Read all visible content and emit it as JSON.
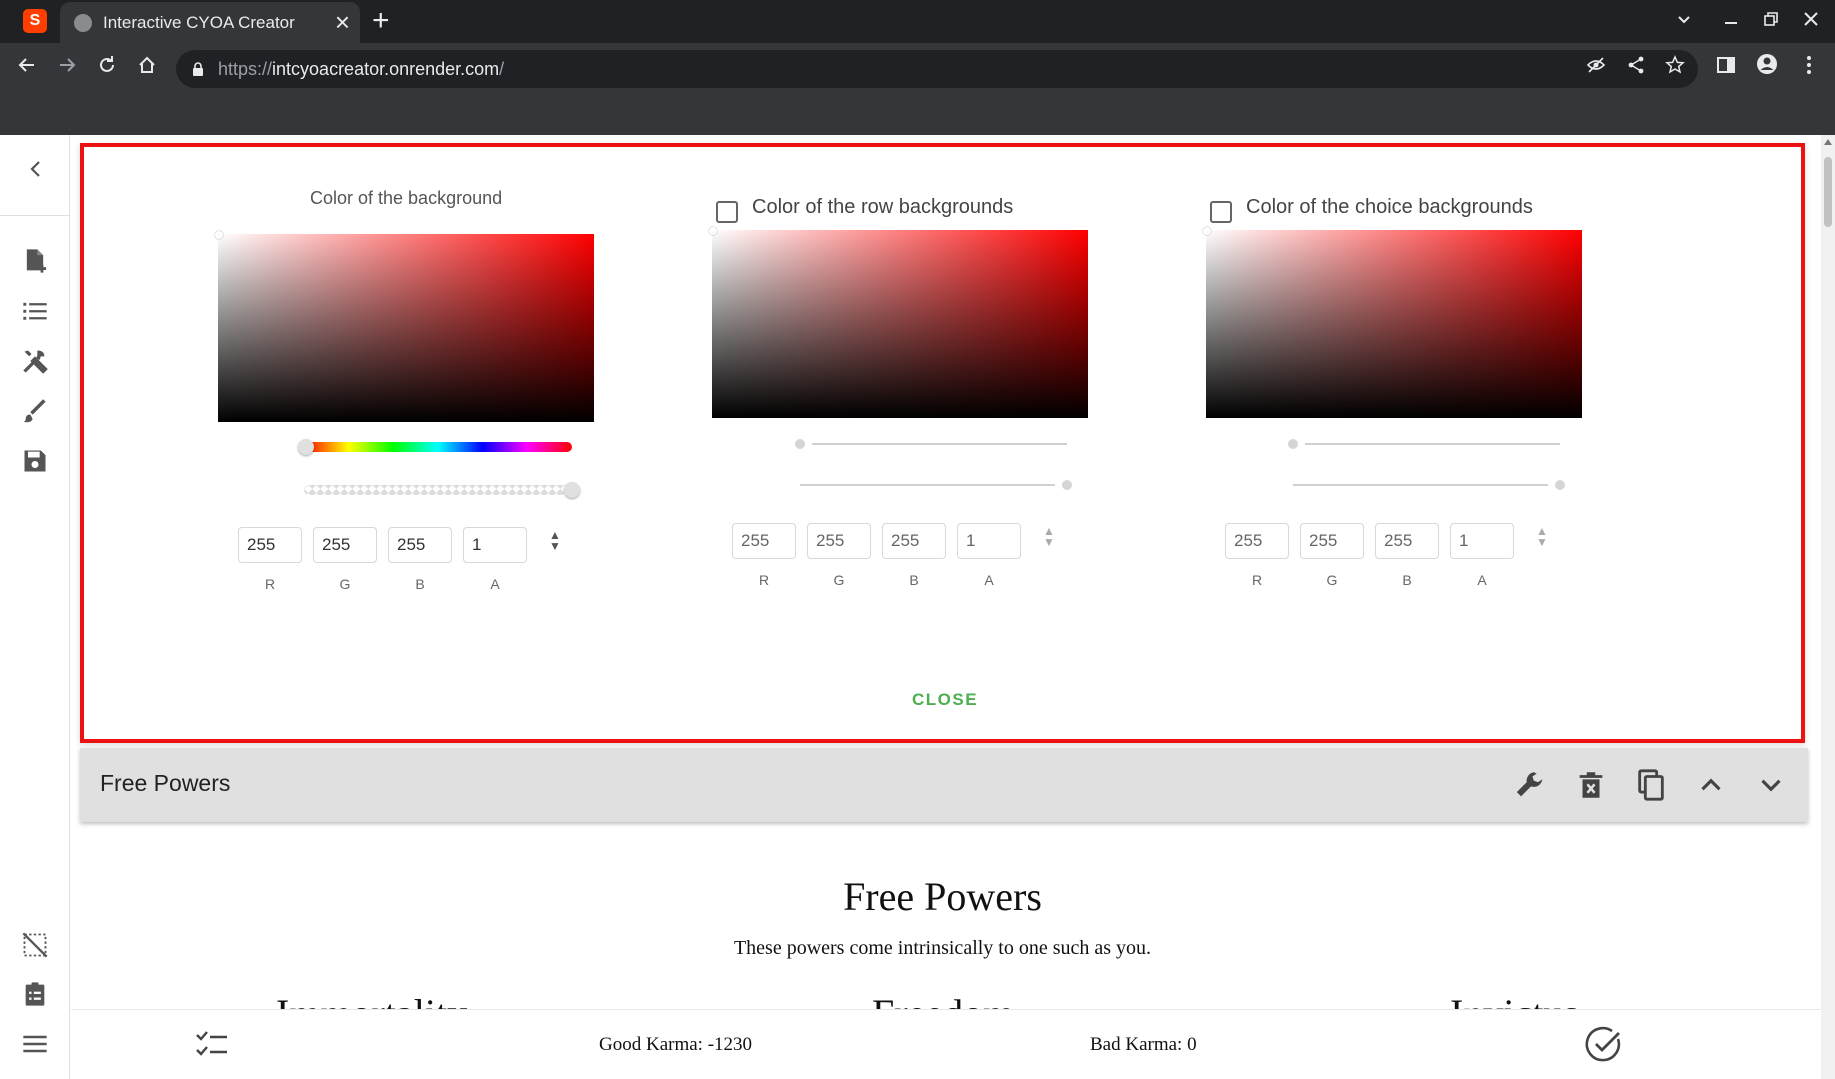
{
  "browser": {
    "tab_title": "Interactive CYOA Creator",
    "url_scheme": "https://",
    "url_host": "intcyoacreator.onrender.com",
    "url_path": "/",
    "app_logo": "S"
  },
  "dialog": {
    "pickers": [
      {
        "title": "Color of the background",
        "has_checkbox": false,
        "checked": false,
        "r": "255",
        "g": "255",
        "b": "255",
        "a": "1",
        "labels": {
          "r": "R",
          "g": "G",
          "b": "B",
          "a": "A"
        }
      },
      {
        "title": "Color of the row backgrounds",
        "has_checkbox": true,
        "checked": false,
        "r": "255",
        "g": "255",
        "b": "255",
        "a": "1",
        "labels": {
          "r": "R",
          "g": "G",
          "b": "B",
          "a": "A"
        }
      },
      {
        "title": "Color of the choice backgrounds",
        "has_checkbox": true,
        "checked": false,
        "r": "255",
        "g": "255",
        "b": "255",
        "a": "1",
        "labels": {
          "r": "R",
          "g": "G",
          "b": "B",
          "a": "A"
        }
      }
    ],
    "close_label": "CLOSE"
  },
  "row": {
    "header_title": "Free Powers",
    "title": "Free Powers",
    "description": "These powers come intrinsically to one such as you.",
    "choices": [
      "Immortality",
      "Freedom",
      "Invictus"
    ]
  },
  "points": {
    "good_karma": "Good Karma: -1230",
    "bad_karma": "Bad Karma: 0"
  },
  "colors": {
    "accent_green": "#4caf50",
    "highlight_red": "#ee1111",
    "row_bar": "#e0e0e0",
    "chrome_dark": "#202124"
  },
  "icons": {
    "sidebar": [
      "new-file-icon",
      "list-icon",
      "tools-icon",
      "brush-icon",
      "save-icon",
      "grid-off-icon",
      "clipboard-icon",
      "menu-icon"
    ],
    "row_actions": [
      "wrench-icon",
      "delete-icon",
      "copy-icon",
      "chevron-up-icon",
      "chevron-down-icon"
    ]
  }
}
